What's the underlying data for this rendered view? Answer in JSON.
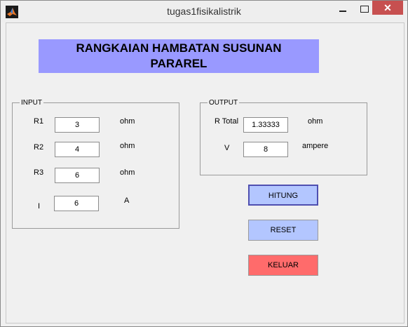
{
  "window": {
    "title": "tugas1fisikalistrik"
  },
  "heading": {
    "line1": "RANGKAIAN HAMBATAN SUSUNAN",
    "line2": "PARAREL"
  },
  "input": {
    "legend": "INPUT",
    "r1_label": "R1",
    "r1_value": "3",
    "r1_unit": "ohm",
    "r2_label": "R2",
    "r2_value": "4",
    "r2_unit": "ohm",
    "r3_label": "R3",
    "r3_value": "6",
    "r3_unit": "ohm",
    "i_label": "I",
    "i_value": "6",
    "i_unit": "A"
  },
  "output": {
    "legend": "OUTPUT",
    "rtotal_label": "R Total",
    "rtotal_value": "1.33333",
    "rtotal_unit": "ohm",
    "v_label": "V",
    "v_value": "8",
    "v_unit": "ampere"
  },
  "buttons": {
    "hitung": "HITUNG",
    "reset": "RESET",
    "keluar": "KELUAR"
  },
  "colors": {
    "heading_bg": "#9999ff",
    "button_blue": "#b3c6ff",
    "button_red": "#ff6b6b"
  },
  "icons": {
    "app": "matlab-icon"
  }
}
